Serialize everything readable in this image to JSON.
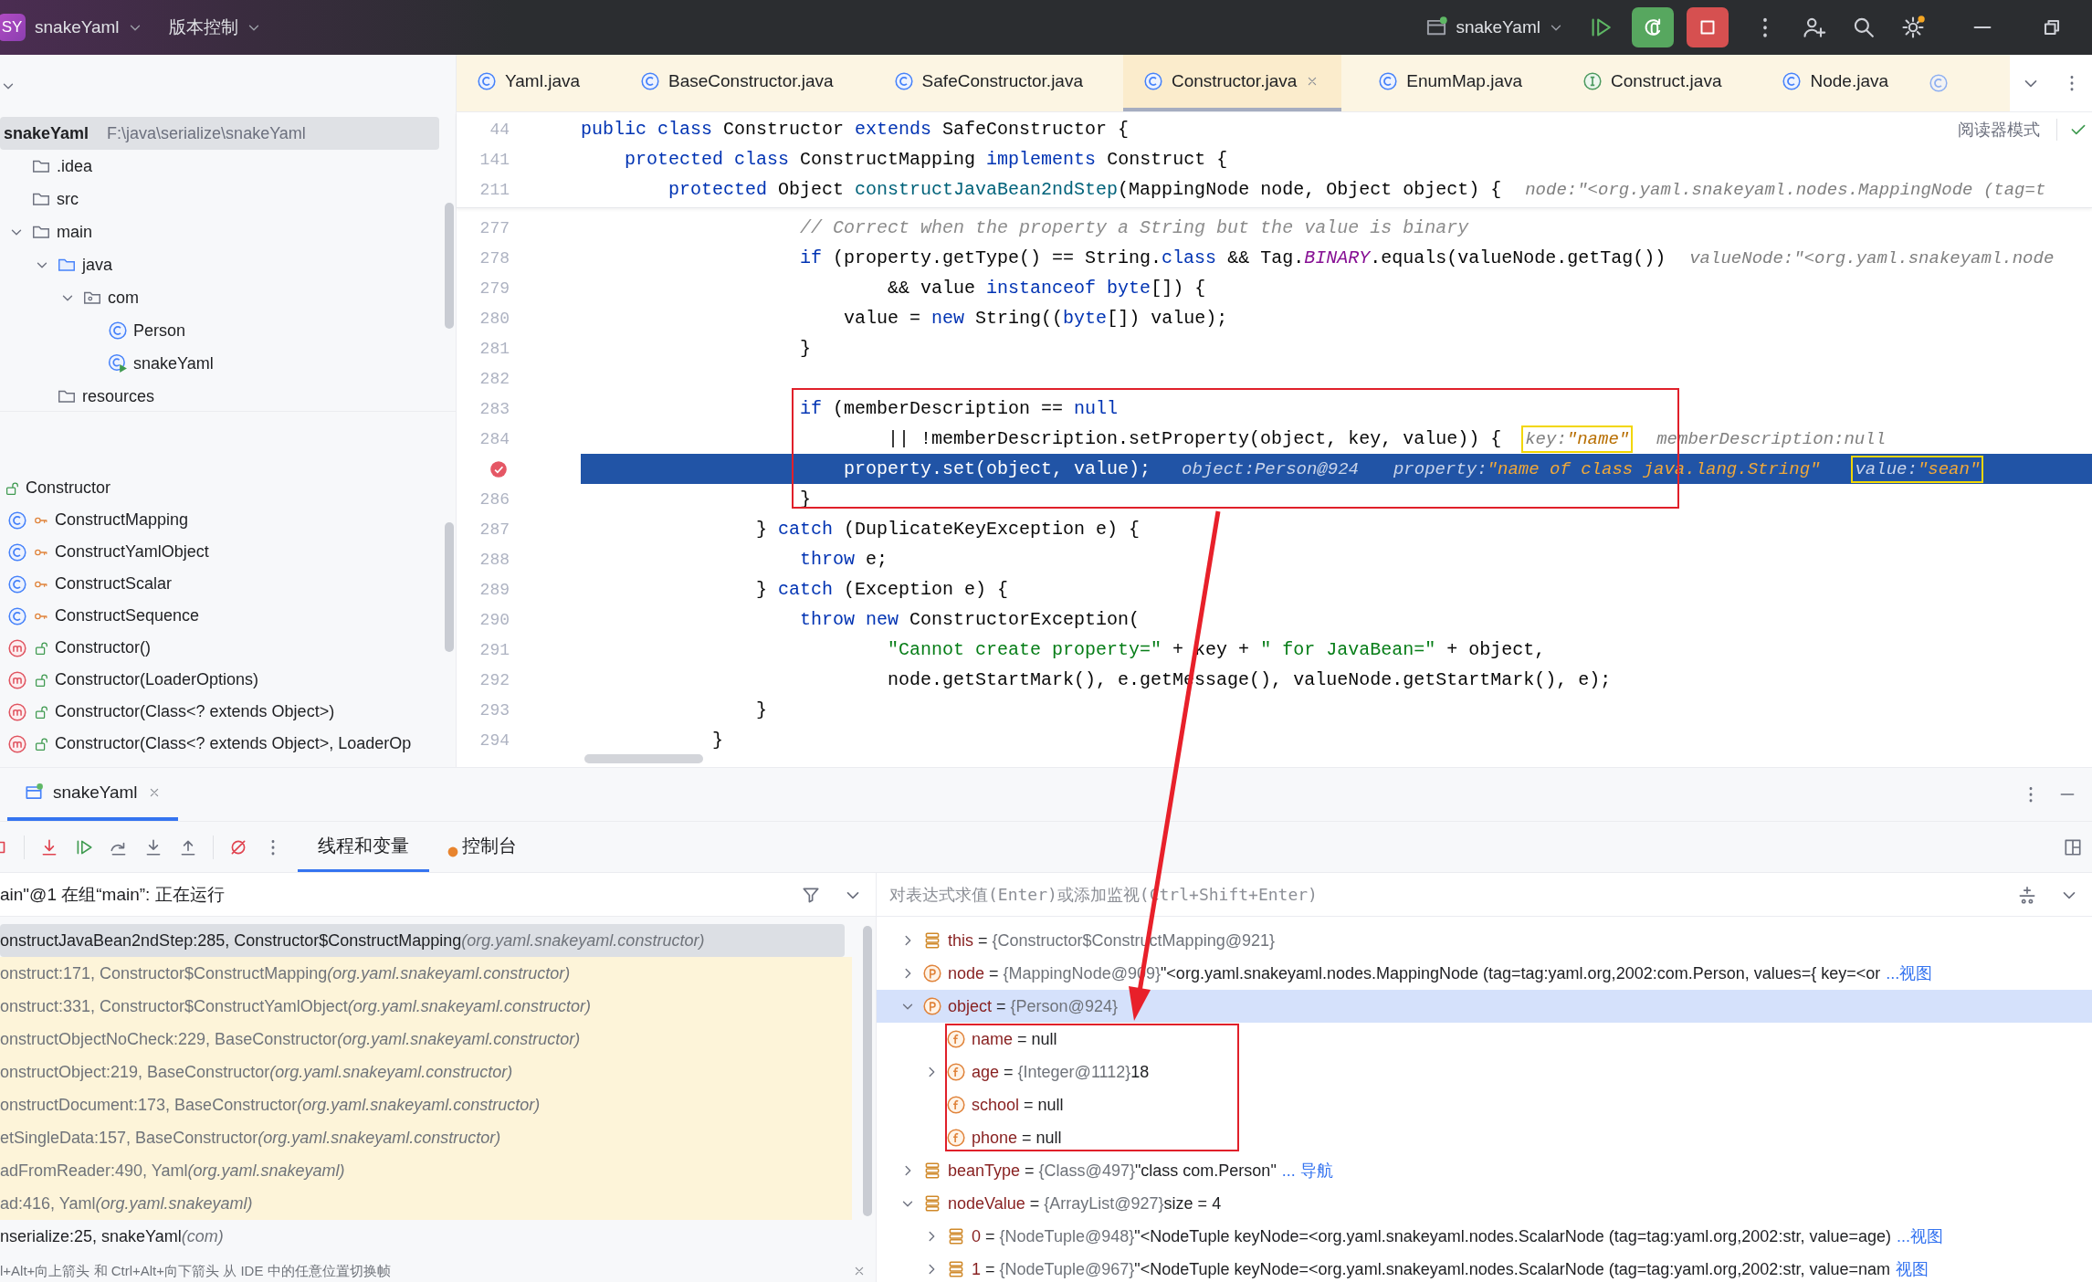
{
  "title_bar": {
    "badge": "SY",
    "project": "snakeYaml",
    "vcs": "版本控制",
    "run_config": "snakeYaml"
  },
  "project_tree": {
    "items": [
      {
        "name": "snakeYaml",
        "path": "F:\\java\\serialize\\snakeYaml",
        "kind": "project",
        "selected": true,
        "children": [
          {
            "name": ".idea",
            "kind": "folder",
            "selected": false
          },
          {
            "name": "src",
            "kind": "folder",
            "selected": false
          },
          {
            "name": "main",
            "kind": "folder",
            "selected": false,
            "expanded": true,
            "children": [
              {
                "name": "java",
                "kind": "source",
                "selected": false,
                "expanded": true,
                "children": [
                  {
                    "name": "com",
                    "kind": "package",
                    "selected": false,
                    "expanded": true,
                    "children": [
                      {
                        "name": "Person",
                        "kind": "class",
                        "selected": false
                      },
                      {
                        "name": "snakeYaml",
                        "kind": "mainclass",
                        "selected": false
                      }
                    ]
                  }
                ]
              },
              {
                "name": "resources",
                "kind": "folder",
                "selected": false
              }
            ]
          }
        ]
      }
    ]
  },
  "structure": {
    "items": [
      {
        "label": "Constructor",
        "kind": "root",
        "protected": false
      },
      {
        "label": "ConstructMapping",
        "kind": "class",
        "protected": true
      },
      {
        "label": "ConstructYamlObject",
        "kind": "class",
        "protected": true
      },
      {
        "label": "ConstructScalar",
        "kind": "class",
        "protected": true
      },
      {
        "label": "ConstructSequence",
        "kind": "class",
        "protected": true
      },
      {
        "label": "Constructor()",
        "kind": "method",
        "protected": false
      },
      {
        "label": "Constructor(LoaderOptions)",
        "kind": "method",
        "protected": false
      },
      {
        "label": "Constructor(Class<? extends Object>)",
        "kind": "method",
        "protected": false
      },
      {
        "label": "Constructor(Class<? extends Object>, LoaderOp",
        "kind": "method",
        "protected": false
      }
    ]
  },
  "editor": {
    "tabs": [
      {
        "label": "Yaml.java",
        "kind": "class",
        "selected": false
      },
      {
        "label": "BaseConstructor.java",
        "kind": "class",
        "selected": false
      },
      {
        "label": "SafeConstructor.java",
        "kind": "class",
        "selected": false
      },
      {
        "label": "Constructor.java",
        "kind": "class",
        "selected": true
      },
      {
        "label": "EnumMap.java",
        "kind": "class",
        "selected": false
      },
      {
        "label": "Construct.java",
        "kind": "interface",
        "selected": false
      },
      {
        "label": "Node.java",
        "kind": "class",
        "selected": false
      }
    ],
    "reader_mode": "阅读器模式",
    "sticky_lines": [
      {
        "number": "44",
        "tokens": [
          {
            "kind": "keyword",
            "text": "public class"
          },
          {
            "kind": "plain",
            "text": " Constructor "
          },
          {
            "kind": "keyword",
            "text": "extends"
          },
          {
            "kind": "plain",
            "text": " SafeConstructor {"
          }
        ]
      },
      {
        "number": "141",
        "tokens": [
          {
            "kind": "keyword",
            "text": "    protected class"
          },
          {
            "kind": "plain",
            "text": " ConstructMapping "
          },
          {
            "kind": "keyword",
            "text": "implements"
          },
          {
            "kind": "plain",
            "text": " Construct {"
          }
        ]
      },
      {
        "number": "211",
        "tokens": [
          {
            "kind": "keyword",
            "text": "        protected"
          },
          {
            "kind": "plain",
            "text": " Object "
          },
          {
            "kind": "method",
            "text": "constructJavaBean2ndStep"
          },
          {
            "kind": "plain",
            "text": "(MappingNode node, Object object) {"
          }
        ],
        "hints": [
          {
            "label": "node:",
            "value": "\"<org.yaml.snakeyaml.nodes.MappingNode (tag=t",
            "kind": "object",
            "boxed": false
          }
        ]
      }
    ],
    "lines": [
      {
        "number": "277",
        "tokens": [
          {
            "kind": "comment",
            "text": "                    // Correct when the property a String but the value is binary"
          }
        ]
      },
      {
        "number": "278",
        "tokens": [
          {
            "kind": "keyword",
            "text": "                    if"
          },
          {
            "kind": "plain",
            "text": " (property.getType() == String."
          },
          {
            "kind": "keyword",
            "text": "class"
          },
          {
            "kind": "plain",
            "text": " && Tag."
          },
          {
            "kind": "constant",
            "text": "BINARY"
          },
          {
            "kind": "plain",
            "text": ".equals(valueNode.getTag())"
          }
        ],
        "hints": [
          {
            "label": "valueNode:",
            "value": "\"<org.yaml.snakeyaml.node",
            "kind": "object",
            "boxed": false
          }
        ]
      },
      {
        "number": "279",
        "tokens": [
          {
            "kind": "plain",
            "text": "                            && value "
          },
          {
            "kind": "keyword",
            "text": "instanceof"
          },
          {
            "kind": "keyword",
            "text": " byte"
          },
          {
            "kind": "plain",
            "text": "[]) {"
          }
        ]
      },
      {
        "number": "280",
        "tokens": [
          {
            "kind": "plain",
            "text": "                        value = "
          },
          {
            "kind": "keyword",
            "text": "new"
          },
          {
            "kind": "plain",
            "text": " String(("
          },
          {
            "kind": "keyword",
            "text": "byte"
          },
          {
            "kind": "plain",
            "text": "[]) value);"
          }
        ]
      },
      {
        "number": "281",
        "tokens": [
          {
            "kind": "plain",
            "text": "                    }"
          }
        ]
      },
      {
        "number": "282"
      },
      {
        "number": "283",
        "tokens": [
          {
            "kind": "keyword",
            "text": "                    if"
          },
          {
            "kind": "plain",
            "text": " (memberDescription == "
          },
          {
            "kind": "keyword",
            "text": "null"
          }
        ]
      },
      {
        "number": "284",
        "tokens": [
          {
            "kind": "plain",
            "text": "                            || !memberDescription.setProperty(object, key, value)) {"
          }
        ],
        "hints": [
          {
            "label": "key:",
            "value": "\"name\"",
            "kind": "string",
            "boxed": true
          },
          {
            "label": "memberDescription:",
            "value": "null",
            "kind": "object",
            "boxed": false
          }
        ]
      },
      {
        "current": true,
        "breakpoint": true,
        "tokens": [
          {
            "kind": "plain",
            "text": "                        property.set(object, value);"
          }
        ],
        "hints": [
          {
            "label": "object:",
            "value": "Person@924",
            "kind": "object",
            "boxed": false
          },
          {
            "label": "property:",
            "value": "\"name of class java.lang.String\"",
            "kind": "string",
            "boxed": false
          },
          {
            "label": "value:",
            "value": "\"sean\"",
            "kind": "string",
            "boxed": true
          }
        ]
      },
      {
        "number": "286",
        "tokens": [
          {
            "kind": "plain",
            "text": "                    }"
          }
        ]
      },
      {
        "number": "287",
        "tokens": [
          {
            "kind": "plain",
            "text": "                } "
          },
          {
            "kind": "keyword",
            "text": "catch"
          },
          {
            "kind": "plain",
            "text": " (DuplicateKeyException e) {"
          }
        ]
      },
      {
        "number": "288",
        "tokens": [
          {
            "kind": "keyword",
            "text": "                    throw"
          },
          {
            "kind": "plain",
            "text": " e;"
          }
        ]
      },
      {
        "number": "289",
        "tokens": [
          {
            "kind": "plain",
            "text": "                } "
          },
          {
            "kind": "keyword",
            "text": "catch"
          },
          {
            "kind": "plain",
            "text": " (Exception e) {"
          }
        ]
      },
      {
        "number": "290",
        "tokens": [
          {
            "kind": "keyword",
            "text": "                    throw new"
          },
          {
            "kind": "plain",
            "text": " ConstructorException("
          }
        ]
      },
      {
        "number": "291",
        "tokens": [
          {
            "kind": "string",
            "text": "                            \"Cannot create property=\""
          },
          {
            "kind": "plain",
            "text": " + key + "
          },
          {
            "kind": "string",
            "text": "\" for JavaBean=\""
          },
          {
            "kind": "plain",
            "text": " + object,"
          }
        ]
      },
      {
        "number": "292",
        "tokens": [
          {
            "kind": "plain",
            "text": "                            node.getStartMark(), e.getMessage(), valueNode.getStartMark(), e);"
          }
        ]
      },
      {
        "number": "293",
        "tokens": [
          {
            "kind": "plain",
            "text": "                }"
          }
        ]
      },
      {
        "number": "294",
        "tokens": [
          {
            "kind": "plain",
            "text": "            }"
          }
        ]
      }
    ]
  },
  "debug": {
    "session_tab": "snakeYaml",
    "view_tabs": [
      {
        "label": "线程和变量",
        "selected": true,
        "notification": false
      },
      {
        "label": "控制台",
        "selected": false,
        "notification": true
      }
    ],
    "thread": "ain\"@1 在组“main”: 正在运行",
    "frames": [
      {
        "location": "onstructJavaBean2ndStep:285, Constructor$ConstructMapping",
        "package": "(org.yaml.snakeyaml.constructor)",
        "selected": true,
        "library": true
      },
      {
        "location": "onstruct:171, Constructor$ConstructMapping",
        "package": "(org.yaml.snakeyaml.constructor)",
        "selected": false,
        "library": true
      },
      {
        "location": "onstruct:331, Constructor$ConstructYamlObject",
        "package": "(org.yaml.snakeyaml.constructor)",
        "selected": false,
        "library": true
      },
      {
        "location": "onstructObjectNoCheck:229, BaseConstructor",
        "package": "(org.yaml.snakeyaml.constructor)",
        "selected": false,
        "library": true
      },
      {
        "location": "onstructObject:219, BaseConstructor",
        "package": "(org.yaml.snakeyaml.constructor)",
        "selected": false,
        "library": true
      },
      {
        "location": "onstructDocument:173, BaseConstructor",
        "package": "(org.yaml.snakeyaml.constructor)",
        "selected": false,
        "library": true
      },
      {
        "location": "etSingleData:157, BaseConstructor",
        "package": "(org.yaml.snakeyaml.constructor)",
        "selected": false,
        "library": true
      },
      {
        "location": "adFromReader:490, Yaml",
        "package": "(org.yaml.snakeyaml)",
        "selected": false,
        "library": true
      },
      {
        "location": "ad:416, Yaml",
        "package": "(org.yaml.snakeyaml)",
        "selected": false,
        "library": true
      },
      {
        "location": "nserialize:25, snakeYaml",
        "package": "(com)",
        "selected": false,
        "library": false
      }
    ],
    "frames_hint": "l+Alt+向上箭头 和 Ctrl+Alt+向下箭头 从 IDE 中的任意位置切换帧",
    "eval_placeholder": "对表达式求值(Enter)或添加监视(Ctrl+Shift+Enter)",
    "variables": [
      {
        "name": "this",
        "separator": "=",
        "type": "{Constructor$ConstructMapping@921}",
        "kind": "local",
        "expandable": true,
        "expanded": false,
        "selected": false
      },
      {
        "name": "node",
        "separator": "=",
        "type": "{MappingNode@909}",
        "value": "\"<org.yaml.snakeyaml.nodes.MappingNode (tag=tag:yaml.org,2002:com.Person, values={ key=<or",
        "link": "...视图",
        "kind": "param",
        "expandable": true,
        "expanded": false,
        "selected": false
      },
      {
        "name": "object",
        "separator": "=",
        "type": "{Person@924}",
        "kind": "param",
        "expandable": true,
        "expanded": true,
        "selected": true,
        "children": [
          {
            "name": "name",
            "separator": "=",
            "value": "null",
            "kind": "field",
            "expandable": false,
            "selected": false
          },
          {
            "name": "age",
            "separator": "=",
            "type": "{Integer@1112}",
            "value": "18",
            "kind": "field",
            "expandable": true,
            "expanded": false,
            "selected": false
          },
          {
            "name": "school",
            "separator": "=",
            "value": "null",
            "kind": "field",
            "expandable": false,
            "selected": false
          },
          {
            "name": "phone",
            "separator": "=",
            "value": "null",
            "kind": "field",
            "expandable": false,
            "selected": false
          }
        ]
      },
      {
        "name": "beanType",
        "separator": "=",
        "type": "{Class@497}",
        "value": "\"class com.Person\"",
        "link": "... 导航",
        "kind": "local",
        "expandable": true,
        "expanded": false,
        "selected": false
      },
      {
        "name": "nodeValue",
        "separator": "=",
        "type": "{ArrayList@927}",
        "value": "size = 4",
        "kind": "local",
        "expandable": true,
        "expanded": true,
        "selected": false,
        "children": [
          {
            "name": "0",
            "separator": "=",
            "type": "{NodeTuple@948}",
            "value": "\"<NodeTuple keyNode=<org.yaml.snakeyaml.nodes.ScalarNode (tag=tag:yaml.org,2002:str, value=age)",
            "link": "...视图",
            "kind": "local",
            "expandable": true,
            "expanded": false,
            "selected": false
          },
          {
            "name": "1",
            "separator": "=",
            "type": "{NodeTuple@967}",
            "value": "\"<NodeTuple keyNode=<org.yaml.snakeyaml.nodes.ScalarNode (tag=tag:yaml.org,2002:str, value=nam",
            "link": "视图",
            "kind": "local",
            "expandable": true,
            "expanded": false,
            "selected": false
          }
        ]
      }
    ]
  }
}
